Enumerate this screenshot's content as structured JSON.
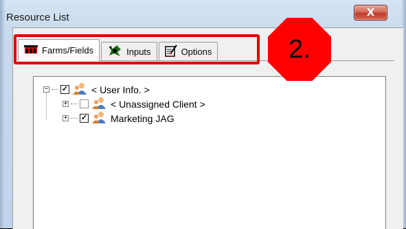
{
  "window": {
    "title": "Resource List",
    "close_label": "X"
  },
  "tabs": [
    {
      "label": "Farms/Fields",
      "icon": "farm-icon",
      "active": true
    },
    {
      "label": "Inputs",
      "icon": "inputs-icon",
      "active": false
    },
    {
      "label": "Options",
      "icon": "options-icon",
      "active": false
    }
  ],
  "annotation": {
    "badge_text": "2.",
    "highlight_color": "#e00000",
    "badge_color": "#ff0000"
  },
  "tree": {
    "nodes": [
      {
        "label": "< User Info. >",
        "checked": true,
        "expander": "−",
        "icon": "user-icon"
      },
      {
        "label": "< Unassigned Client >",
        "checked": false,
        "expander": "+",
        "icon": "user-icon"
      },
      {
        "label": "Marketing JAG",
        "checked": true,
        "expander": "+",
        "icon": "user-icon"
      }
    ]
  }
}
